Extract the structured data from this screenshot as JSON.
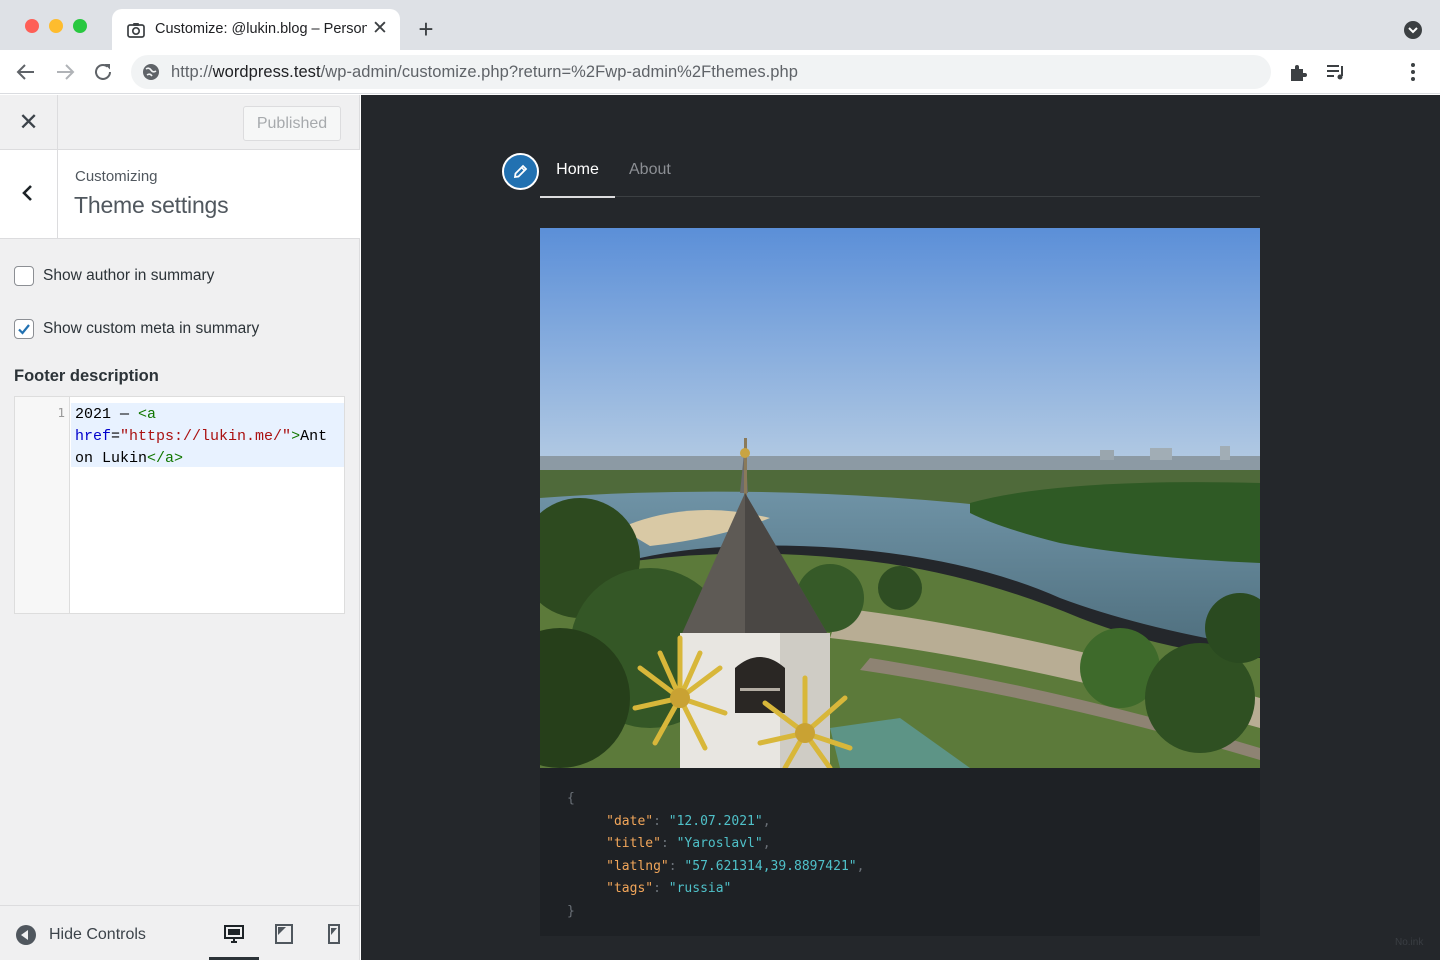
{
  "browser": {
    "tab_title": "Customize: @lukin.blog – Personal blog",
    "tab_close": "✕",
    "new_tab": "+",
    "url_scheme": "http://",
    "url_host": "wordpress.test",
    "url_path": "/wp-admin/customize.php?return=%2Fwp-admin%2Fthemes.php"
  },
  "customizer": {
    "close": "✕",
    "publish_label": "Published",
    "customizing_label": "Customizing",
    "section_title": "Theme settings",
    "options": [
      {
        "label": "Show author in summary",
        "checked": false
      },
      {
        "label": "Show custom meta in summary",
        "checked": true
      }
    ],
    "footer_label": "Footer description",
    "code": {
      "line_number": "1",
      "text": "2021 — <a href=\"https://lukin.me/\">Anton Lukin</a>"
    },
    "hide_controls": "Hide Controls",
    "devices": [
      "desktop",
      "tablet",
      "mobile"
    ],
    "accent_color": "#2271b1"
  },
  "preview": {
    "nav": [
      "Home",
      "About"
    ],
    "active_nav": "Home",
    "json_lines": [
      {
        "kind": "brace",
        "text": "{"
      },
      {
        "kind": "pair",
        "key": "\"date\"",
        "value": "\"12.07.2021\"",
        "comma": true
      },
      {
        "kind": "pair",
        "key": "\"title\"",
        "value": "\"Yaroslavl\"",
        "comma": true
      },
      {
        "kind": "pair",
        "key": "\"latlng\"",
        "value": "\"57.621314,39.8897421\"",
        "comma": true
      },
      {
        "kind": "pair",
        "key": "\"tags\"",
        "value": "\"russia\"",
        "comma": false
      },
      {
        "kind": "brace",
        "text": "}"
      }
    ],
    "watermark": "No.ink"
  }
}
